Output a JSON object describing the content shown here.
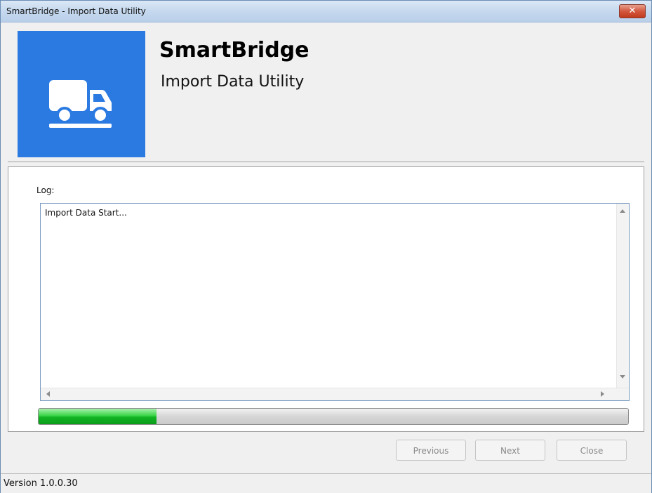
{
  "window": {
    "title": "SmartBridge - Import Data Utility",
    "close_label": "✕"
  },
  "header": {
    "app_name": "SmartBridge",
    "subtitle": "Import Data Utility",
    "logo_icon": "truck-icon",
    "logo_color": "#2a7ae2"
  },
  "log": {
    "label": "Log:",
    "content": "Import Data Start..."
  },
  "progress": {
    "value_percent": 20
  },
  "buttons": {
    "previous": "Previous",
    "next": "Next",
    "close": "Close"
  },
  "status": {
    "version": "Version 1.0.0.30"
  }
}
